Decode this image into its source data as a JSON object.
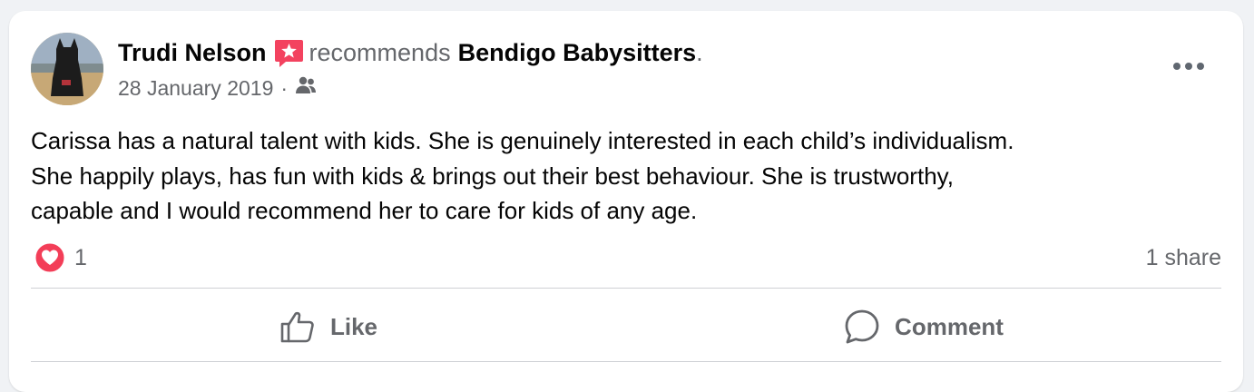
{
  "post": {
    "author": "Trudi Nelson",
    "verb": "recommends",
    "page": "Bendigo Babysitters",
    "end_punct": ".",
    "date": "28 January 2019",
    "separator": "·",
    "audience_icon": "friends-icon",
    "lines": [
      "Carissa has a natural talent with kids. She is genuinely interested in each child’s individualism.",
      "She happily plays, has fun with kids & brings out their best behaviour. She is trustworthy,",
      "capable and I would recommend her to care for kids of any age."
    ]
  },
  "stats": {
    "reaction_icon": "love-heart-icon",
    "reaction_count": "1",
    "shares": "1 share"
  },
  "actions": {
    "like": "Like",
    "comment": "Comment"
  },
  "colors": {
    "recommend_badge": "#f3425f",
    "love_reaction": "#f33e58",
    "secondary_text": "#65676b"
  }
}
